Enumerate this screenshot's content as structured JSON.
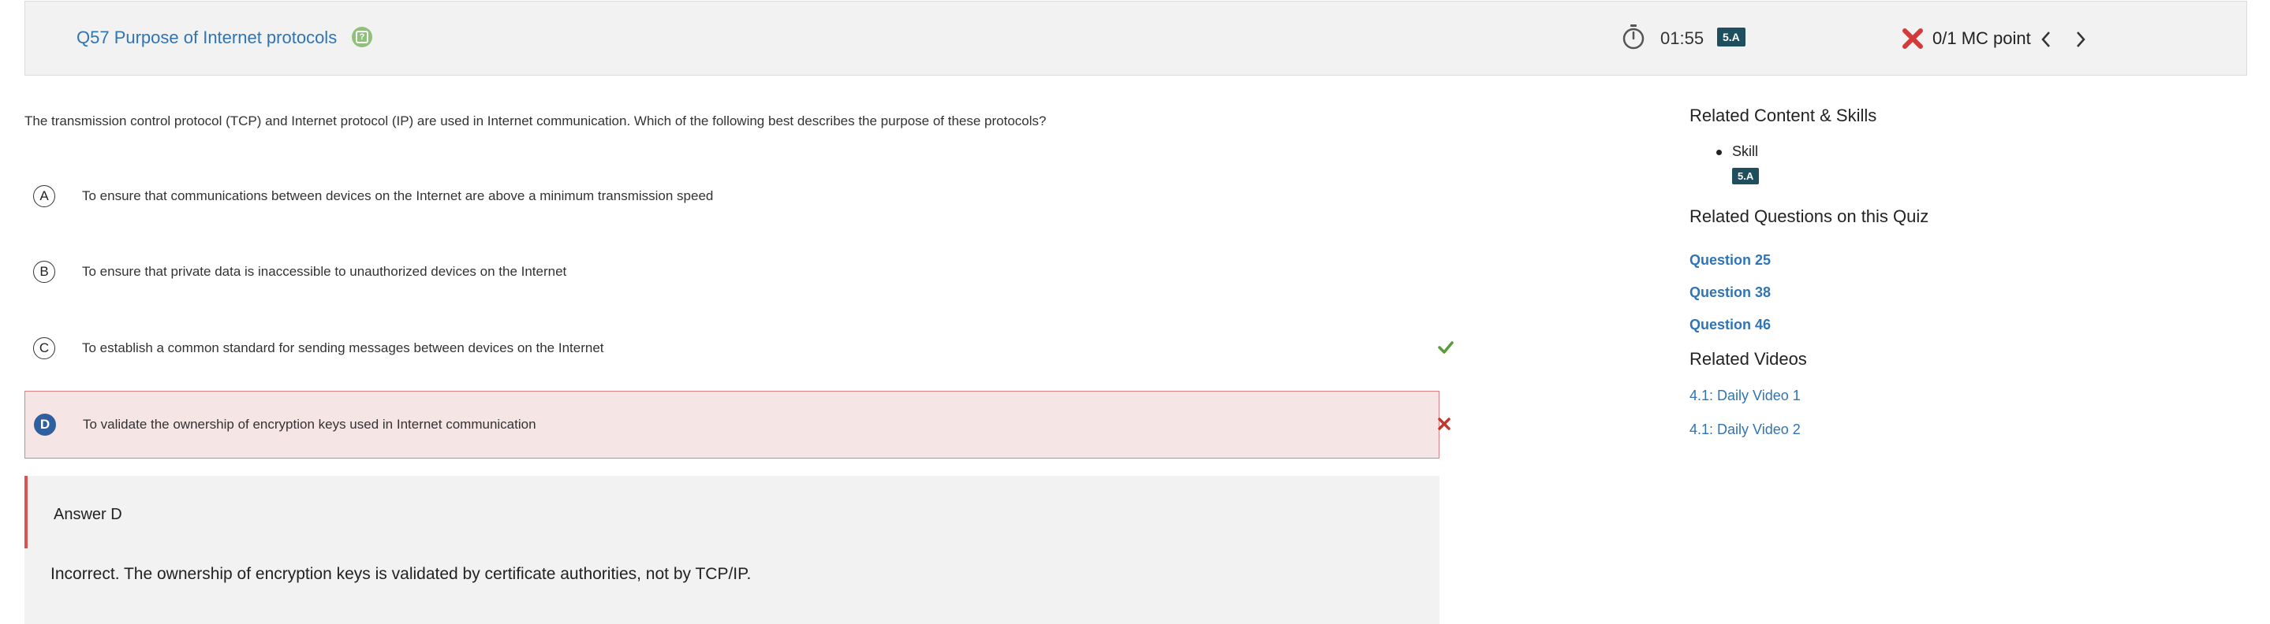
{
  "header": {
    "question_title": "Q57 Purpose of Internet protocols",
    "timer": "01:55",
    "skill_badge": "5.A",
    "score": "0/1 MC point"
  },
  "question": {
    "prompt": "The transmission control protocol (TCP) and Internet protocol (IP) are used in Internet communication. Which of the following best describes the purpose of these protocols?",
    "options": [
      {
        "letter": "A",
        "text": "To ensure that communications between devices on the Internet are above a minimum transmission speed"
      },
      {
        "letter": "B",
        "text": "To ensure that private data is inaccessible to unauthorized devices on the Internet"
      },
      {
        "letter": "C",
        "text": "To establish a common standard for sending messages between devices on the Internet",
        "mark": "correct"
      },
      {
        "letter": "D",
        "text": "To validate the ownership of encryption keys used in Internet communication",
        "mark": "incorrect",
        "selected": true
      }
    ]
  },
  "feedback": {
    "answer_label": "Answer D",
    "text": "Incorrect. The ownership of encryption keys is validated by certificate authorities, not by TCP/IP."
  },
  "sidebar": {
    "related_content_heading": "Related Content & Skills",
    "skill_label": "Skill",
    "skill_badge": "5.A",
    "related_questions_heading": "Related Questions on this Quiz",
    "questions": [
      "Question 25",
      "Question 38",
      "Question 46"
    ],
    "related_videos_heading": "Related Videos",
    "videos": [
      "4.1: Daily Video 1",
      "4.1: Daily Video 2"
    ]
  },
  "colors": {
    "link_blue": "#2f74b5",
    "badge_teal": "#1f4e5f",
    "correct_green": "#5a9a3c",
    "incorrect_red": "#d9534f",
    "selected_bg": "#f6e5e5",
    "help_icon_green": "#8fc17a"
  },
  "icons": [
    "help-icon",
    "stopwatch-icon",
    "x-icon",
    "chevron-left-icon",
    "chevron-right-icon",
    "check-icon",
    "close-icon"
  ]
}
